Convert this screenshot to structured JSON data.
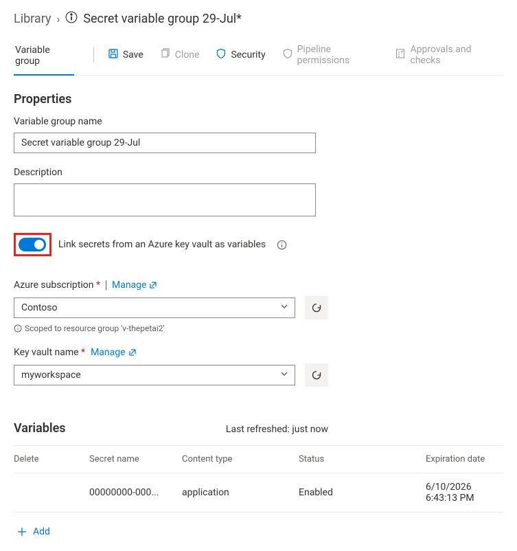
{
  "breadcrumb": {
    "parent": "Library",
    "current": "Secret variable group 29-Jul*"
  },
  "tabs": {
    "variableGroup": "Variable group"
  },
  "toolbar": {
    "save": "Save",
    "clone": "Clone",
    "security": "Security",
    "pipelinePermissions": "Pipeline permissions",
    "approvalsChecks": "Approvals and checks"
  },
  "sections": {
    "propertiesTitle": "Properties",
    "variablesTitle": "Variables"
  },
  "fields": {
    "nameLabel": "Variable group name",
    "nameValue": "Secret variable group 29-Jul",
    "descLabel": "Description",
    "descValue": "",
    "linkToggleLabel": "Link secrets from an Azure key vault as variables",
    "subscriptionLabel": "Azure subscription",
    "subscriptionValue": "Contoso",
    "subscriptionHelper": "Scoped to resource group 'v-thepetai2'",
    "kvLabel": "Key vault name",
    "kvValue": "myworkspace",
    "manage": "Manage"
  },
  "variables": {
    "lastRefreshed": "Last refreshed: just now",
    "columns": {
      "delete": "Delete",
      "secretName": "Secret name",
      "contentType": "Content type",
      "status": "Status",
      "expiration": "Expiration date"
    },
    "rows": [
      {
        "secretName": "00000000-000...",
        "contentType": "application",
        "status": "Enabled",
        "expiration": "6/10/2026 6:43:13 PM"
      }
    ],
    "addLabel": "Add"
  }
}
